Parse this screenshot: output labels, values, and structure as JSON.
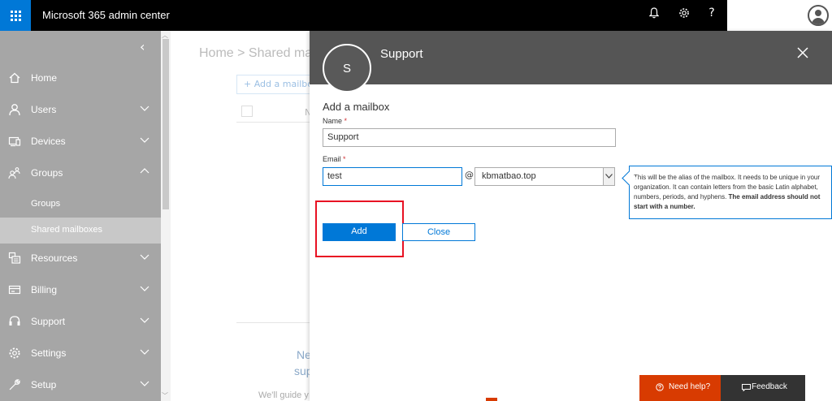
{
  "app": {
    "title": "Microsoft 365 admin center",
    "help_icon": "?"
  },
  "sidebar": {
    "collapse_glyph": "‹",
    "items": [
      {
        "label": "Home",
        "icon": "home-icon",
        "chevron": false
      },
      {
        "label": "Users",
        "icon": "person-icon",
        "chevron": true
      },
      {
        "label": "Devices",
        "icon": "devices-icon",
        "chevron": true
      },
      {
        "label": "Groups",
        "icon": "groups-icon",
        "chevron": true,
        "expanded": true
      },
      {
        "label": "Resources",
        "icon": "resources-icon",
        "chevron": true
      },
      {
        "label": "Billing",
        "icon": "billing-icon",
        "chevron": true
      },
      {
        "label": "Support",
        "icon": "headset-icon",
        "chevron": true
      },
      {
        "label": "Settings",
        "icon": "gear-icon",
        "chevron": true
      },
      {
        "label": "Setup",
        "icon": "wrench-icon",
        "chevron": true
      }
    ],
    "sub_items": [
      {
        "label": "Groups"
      },
      {
        "label": "Shared mailboxes",
        "selected": true
      }
    ]
  },
  "background": {
    "breadcrumb": "Home > Shared mail",
    "add_button": "+ Add a mailbox",
    "column_letter": "N",
    "empty_title_1": "Ne",
    "empty_title_2": "sup",
    "empty_subtitle": "We'll guide y"
  },
  "panel": {
    "avatar_initial": "S",
    "title": "Support",
    "section_title": "Add a mailbox",
    "name_label": "Name",
    "name_value": "Support",
    "email_label": "Email",
    "email_value": "test",
    "at_sign": "@",
    "domain_value": "kbmatbao.top",
    "required_mark": "*",
    "tooltip_text": "This will be the alias of the mailbox. It needs to be unique in your organization. It can contain letters from the basic Latin alphabet, numbers, periods, and hyphens.",
    "tooltip_bold": "The email address should not start with a number.",
    "add_label": "Add",
    "close_label": "Close"
  },
  "footer": {
    "need_help": "Need help?",
    "feedback": "Feedback"
  },
  "colors": {
    "accent": "#0078d7",
    "sidebar": "#a6a6a6",
    "header": "#555555",
    "help": "#d83b01",
    "highlight": "#e81123"
  }
}
